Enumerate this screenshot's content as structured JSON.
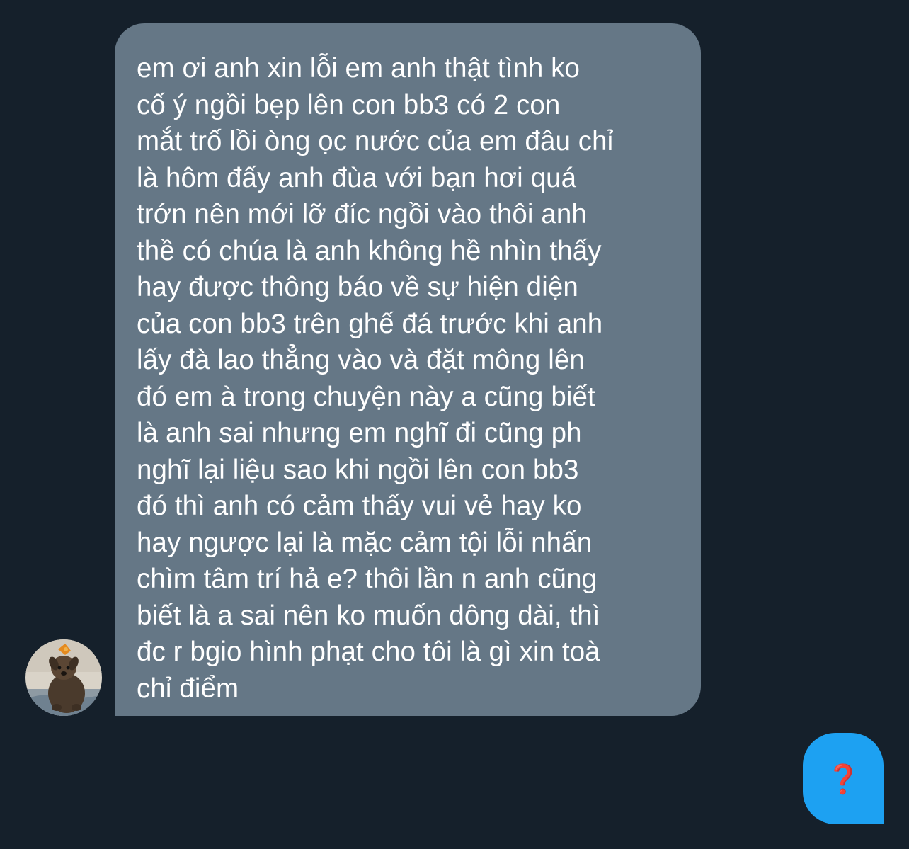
{
  "conversation": {
    "received_message": {
      "lines": [
        "em ơi anh xin lỗi em anh thật tình ko",
        "cố ý ngồi bẹp lên con bb3 có 2 con",
        "mắt trố lồi òng ọc nước của em đâu chỉ",
        "là hôm đấy anh đùa với bạn hơi quá",
        "trớn nên mới lỡ đíc ngồi vào thôi anh",
        "thề có chúa là anh không hề nhìn thấy",
        "hay được thông báo về sự hiện diện",
        "của con bb3 trên ghế đá trước khi anh",
        "lấy đà lao thẳng vào và đặt mông lên",
        "đó em à trong chuyện này a cũng biết",
        "là anh sai nhưng em nghĩ đi cũng ph",
        "nghĩ lại liệu sao khi ngồi lên con bb3",
        "đó thì anh có cảm thấy vui vẻ hay ko",
        "hay ngược lại là mặc cảm tội lỗi nhấn",
        "chìm tâm trí hả e? thôi lần n anh cũng",
        "biết là a sai nên ko muốn dông dài, thì",
        "đc r bgio hình phạt cho tôi là gì xin toà",
        "chỉ điểm"
      ],
      "bubble_color": "#657786"
    },
    "sent_message": {
      "text": "❓",
      "bubble_color": "#1da1f2"
    },
    "avatar": {
      "icon": "dog-avatar-photo"
    },
    "background_color": "#15202b"
  }
}
